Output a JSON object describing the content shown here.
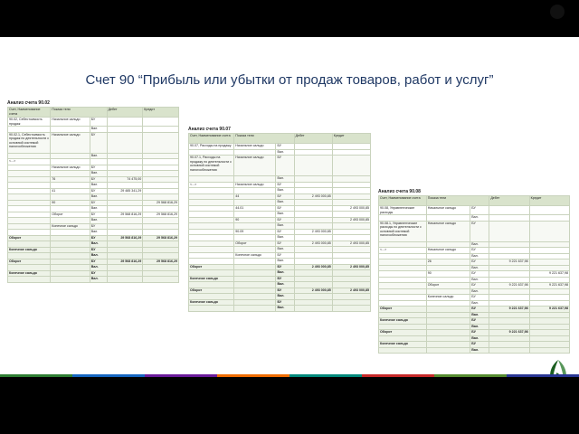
{
  "slide": {
    "title": "Счет 90 “Прибыль или убытки от продаж товаров, работ и услуг”",
    "stripe_colors": [
      "#2e7d32",
      "#1565c0",
      "#6a1b9a",
      "#ef6c00",
      "#00897b",
      "#c62828",
      "#558b2f",
      "#283593"
    ]
  },
  "panels": [
    {
      "title": "Анализ счета 90.02",
      "headers": [
        "Счет, Наименование счета",
        "Показа тели",
        "Дебет",
        "Кредит"
      ],
      "rows": [
        {
          "c1": "90.02, Себестоимость продаж",
          "c2": "Начальное сальдо",
          "c3": "БУ",
          "c4": "",
          "c5": "",
          "s": ""
        },
        {
          "c1": "",
          "c2": "",
          "c3": "Вал.",
          "c4": "",
          "c5": "",
          "s": ""
        },
        {
          "c1": "90.02.1, Себестоимость продаж по деятельности с основной системой налогообложения",
          "c2": "Начальное сальдо",
          "c3": "БУ",
          "c4": "",
          "c5": "",
          "s": "tall"
        },
        {
          "c1": "",
          "c2": "",
          "c3": "Вал.",
          "c4": "",
          "c5": "",
          "s": ""
        },
        {
          "c1": "<...>",
          "c2": "",
          "c3": "",
          "c4": "",
          "c5": "",
          "s": ""
        },
        {
          "c1": "",
          "c2": "Начальное сальдо",
          "c3": "БУ",
          "c4": "",
          "c5": "",
          "s": ""
        },
        {
          "c1": "",
          "c2": "",
          "c3": "Вал.",
          "c4": "",
          "c5": "",
          "s": ""
        },
        {
          "c1": "",
          "c2": "76",
          "c3": "БУ",
          "c4": "74 475,00",
          "c5": "",
          "s": ""
        },
        {
          "c1": "",
          "c2": "",
          "c3": "Вал.",
          "c4": "",
          "c5": "",
          "s": ""
        },
        {
          "c1": "",
          "c2": "41",
          "c3": "БУ",
          "c4": "29 485 341,29",
          "c5": "",
          "s": ""
        },
        {
          "c1": "",
          "c2": "",
          "c3": "Вал.",
          "c4": "",
          "c5": "",
          "s": ""
        },
        {
          "c1": "",
          "c2": "90",
          "c3": "БУ",
          "c4": "",
          "c5": "29 568 816,29",
          "s": ""
        },
        {
          "c1": "",
          "c2": "",
          "c3": "Вал.",
          "c4": "",
          "c5": "",
          "s": ""
        },
        {
          "c1": "",
          "c2": "Оборот",
          "c3": "БУ",
          "c4": "29 568 816,29",
          "c5": "29 568 816,29",
          "s": ""
        },
        {
          "c1": "",
          "c2": "",
          "c3": "Вал.",
          "c4": "",
          "c5": "",
          "s": ""
        },
        {
          "c1": "",
          "c2": "Конечное сальдо",
          "c3": "БУ",
          "c4": "",
          "c5": "",
          "s": ""
        },
        {
          "c1": "",
          "c2": "",
          "c3": "Вал.",
          "c4": "",
          "c5": "",
          "s": ""
        },
        {
          "c1": "Оборот",
          "c2": "",
          "c3": "БУ",
          "c4": "29 568 816,29",
          "c5": "29 568 816,29",
          "s": "tot"
        },
        {
          "c1": "",
          "c2": "",
          "c3": "Вал.",
          "c4": "",
          "c5": "",
          "s": "tot"
        },
        {
          "c1": "Конечное сальдо",
          "c2": "",
          "c3": "БУ",
          "c4": "",
          "c5": "",
          "s": "tot"
        },
        {
          "c1": "",
          "c2": "",
          "c3": "Вал.",
          "c4": "",
          "c5": "",
          "s": "tot"
        },
        {
          "c1": "Оборот",
          "c2": "",
          "c3": "БУ",
          "c4": "29 568 816,29",
          "c5": "29 568 816,29",
          "s": "tot"
        },
        {
          "c1": "",
          "c2": "",
          "c3": "Вал.",
          "c4": "",
          "c5": "",
          "s": "tot"
        },
        {
          "c1": "Конечное сальдо",
          "c2": "",
          "c3": "БУ",
          "c4": "",
          "c5": "",
          "s": "tot"
        },
        {
          "c1": "",
          "c2": "",
          "c3": "Вал.",
          "c4": "",
          "c5": "",
          "s": "tot"
        }
      ]
    },
    {
      "title": "Анализ счета 90.07",
      "headers": [
        "Счет, Наименование счета",
        "Показа тели",
        "Дебет",
        "Кредит"
      ],
      "rows": [
        {
          "c1": "90.07, Расходы на продажу",
          "c2": "Начальное сальдо",
          "c3": "БУ",
          "c4": "",
          "c5": "",
          "s": ""
        },
        {
          "c1": "",
          "c2": "",
          "c3": "Вал.",
          "c4": "",
          "c5": "",
          "s": ""
        },
        {
          "c1": "90.07.1, Расходы на продажу по деятельности с основной системой налогообложения",
          "c2": "Начальное сальдо",
          "c3": "БУ",
          "c4": "",
          "c5": "",
          "s": "tall"
        },
        {
          "c1": "",
          "c2": "",
          "c3": "Вал.",
          "c4": "",
          "c5": "",
          "s": ""
        },
        {
          "c1": "<...>",
          "c2": "Начальное сальдо",
          "c3": "БУ",
          "c4": "",
          "c5": "",
          "s": ""
        },
        {
          "c1": "",
          "c2": "",
          "c3": "Вал.",
          "c4": "",
          "c5": "",
          "s": ""
        },
        {
          "c1": "",
          "c2": "44",
          "c3": "БУ",
          "c4": "2 493 000,85",
          "c5": "",
          "s": ""
        },
        {
          "c1": "",
          "c2": "",
          "c3": "Вал.",
          "c4": "",
          "c5": "",
          "s": ""
        },
        {
          "c1": "",
          "c2": "44.01",
          "c3": "БУ",
          "c4": "",
          "c5": "2 493 000,85",
          "s": ""
        },
        {
          "c1": "",
          "c2": "",
          "c3": "Вал.",
          "c4": "",
          "c5": "",
          "s": ""
        },
        {
          "c1": "",
          "c2": "90",
          "c3": "БУ",
          "c4": "",
          "c5": "2 493 000,85",
          "s": ""
        },
        {
          "c1": "",
          "c2": "",
          "c3": "Вал.",
          "c4": "",
          "c5": "",
          "s": ""
        },
        {
          "c1": "",
          "c2": "90.09",
          "c3": "БУ",
          "c4": "2 493 000,85",
          "c5": "",
          "s": ""
        },
        {
          "c1": "",
          "c2": "",
          "c3": "Вал.",
          "c4": "",
          "c5": "",
          "s": ""
        },
        {
          "c1": "",
          "c2": "Оборот",
          "c3": "БУ",
          "c4": "2 493 000,85",
          "c5": "2 493 000,85",
          "s": ""
        },
        {
          "c1": "",
          "c2": "",
          "c3": "Вал.",
          "c4": "",
          "c5": "",
          "s": ""
        },
        {
          "c1": "",
          "c2": "Конечное сальдо",
          "c3": "БУ",
          "c4": "",
          "c5": "",
          "s": ""
        },
        {
          "c1": "",
          "c2": "",
          "c3": "Вал.",
          "c4": "",
          "c5": "",
          "s": ""
        },
        {
          "c1": "Оборот",
          "c2": "",
          "c3": "БУ",
          "c4": "2 493 000,85",
          "c5": "2 493 000,85",
          "s": "tot"
        },
        {
          "c1": "",
          "c2": "",
          "c3": "Вал.",
          "c4": "",
          "c5": "",
          "s": "tot"
        },
        {
          "c1": "Конечное сальдо",
          "c2": "",
          "c3": "БУ",
          "c4": "",
          "c5": "",
          "s": "tot"
        },
        {
          "c1": "",
          "c2": "",
          "c3": "Вал.",
          "c4": "",
          "c5": "",
          "s": "tot"
        },
        {
          "c1": "Оборот",
          "c2": "",
          "c3": "БУ",
          "c4": "2 493 000,85",
          "c5": "2 493 000,85",
          "s": "tot"
        },
        {
          "c1": "",
          "c2": "",
          "c3": "Вал.",
          "c4": "",
          "c5": "",
          "s": "tot"
        },
        {
          "c1": "Конечное сальдо",
          "c2": "",
          "c3": "БУ",
          "c4": "",
          "c5": "",
          "s": "tot"
        },
        {
          "c1": "",
          "c2": "",
          "c3": "Вал.",
          "c4": "",
          "c5": "",
          "s": "tot"
        }
      ]
    },
    {
      "title": "Анализ счета 90.08",
      "headers": [
        "Счет, Наименование счета",
        "Показа тели",
        "Дебет",
        "Кредит"
      ],
      "rows": [
        {
          "c1": "90.08, Управленческие расходы",
          "c2": "Начальное сальдо",
          "c3": "БУ",
          "c4": "",
          "c5": "",
          "s": ""
        },
        {
          "c1": "",
          "c2": "",
          "c3": "Вал.",
          "c4": "",
          "c5": "",
          "s": ""
        },
        {
          "c1": "90.08.1, Управленческие расходы по деятельности с основной системой налогообложения",
          "c2": "Начальное сальдо",
          "c3": "БУ",
          "c4": "",
          "c5": "",
          "s": "tall"
        },
        {
          "c1": "",
          "c2": "",
          "c3": "Вал.",
          "c4": "",
          "c5": "",
          "s": ""
        },
        {
          "c1": "<...>",
          "c2": "Начальное сальдо",
          "c3": "БУ",
          "c4": "",
          "c5": "",
          "s": ""
        },
        {
          "c1": "",
          "c2": "",
          "c3": "Вал.",
          "c4": "",
          "c5": "",
          "s": ""
        },
        {
          "c1": "",
          "c2": "26",
          "c3": "БУ",
          "c4": "9 221 637,98",
          "c5": "",
          "s": ""
        },
        {
          "c1": "",
          "c2": "",
          "c3": "Вал.",
          "c4": "",
          "c5": "",
          "s": ""
        },
        {
          "c1": "",
          "c2": "90",
          "c3": "БУ",
          "c4": "",
          "c5": "9 221 637,98",
          "s": ""
        },
        {
          "c1": "",
          "c2": "",
          "c3": "Вал.",
          "c4": "",
          "c5": "",
          "s": ""
        },
        {
          "c1": "",
          "c2": "Оборот",
          "c3": "БУ",
          "c4": "9 221 637,98",
          "c5": "9 221 637,98",
          "s": ""
        },
        {
          "c1": "",
          "c2": "",
          "c3": "Вал.",
          "c4": "",
          "c5": "",
          "s": ""
        },
        {
          "c1": "",
          "c2": "Конечное сальдо",
          "c3": "БУ",
          "c4": "",
          "c5": "",
          "s": ""
        },
        {
          "c1": "",
          "c2": "",
          "c3": "Вал.",
          "c4": "",
          "c5": "",
          "s": ""
        },
        {
          "c1": "Оборот",
          "c2": "",
          "c3": "БУ",
          "c4": "9 221 637,98",
          "c5": "9 221 637,98",
          "s": "tot"
        },
        {
          "c1": "",
          "c2": "",
          "c3": "Вал.",
          "c4": "",
          "c5": "",
          "s": "tot"
        },
        {
          "c1": "Конечное сальдо",
          "c2": "",
          "c3": "БУ",
          "c4": "",
          "c5": "",
          "s": "tot"
        },
        {
          "c1": "",
          "c2": "",
          "c3": "Вал.",
          "c4": "",
          "c5": "",
          "s": "tot"
        },
        {
          "c1": "Оборот",
          "c2": "",
          "c3": "БУ",
          "c4": "9 221 637,98",
          "c5": "",
          "s": "tot"
        },
        {
          "c1": "",
          "c2": "",
          "c3": "Вал.",
          "c4": "",
          "c5": "",
          "s": "tot"
        },
        {
          "c1": "Конечное сальдо",
          "c2": "",
          "c3": "БУ",
          "c4": "",
          "c5": "",
          "s": "tot"
        },
        {
          "c1": "",
          "c2": "",
          "c3": "Вал.",
          "c4": "",
          "c5": "",
          "s": "tot"
        }
      ]
    }
  ]
}
